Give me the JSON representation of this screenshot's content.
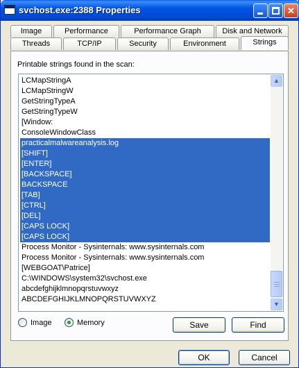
{
  "window": {
    "title": "svchost.exe:2388 Properties"
  },
  "titlebar_buttons": {
    "minimize_icon": "minimize-icon",
    "maximize_icon": "maximize-icon",
    "close_glyph": "✕"
  },
  "tabs_back_row": [
    "Image",
    "Performance",
    "Performance Graph",
    "Disk and Network"
  ],
  "tabs_front_row": [
    "Threads",
    "TCP/IP",
    "Security",
    "Environment",
    "Strings"
  ],
  "active_tab": "Strings",
  "panel": {
    "label": "Printable strings found in the scan:"
  },
  "strings_list": {
    "items": [
      {
        "text": "LCMapStringA",
        "selected": false
      },
      {
        "text": "LCMapStringW",
        "selected": false
      },
      {
        "text": "GetStringTypeA",
        "selected": false
      },
      {
        "text": "GetStringTypeW",
        "selected": false
      },
      {
        "text": "[Window:",
        "selected": false
      },
      {
        "text": "ConsoleWindowClass",
        "selected": false
      },
      {
        "text": "practicalmalwareanalysis.log",
        "selected": true
      },
      {
        "text": "[SHIFT]",
        "selected": true
      },
      {
        "text": "[ENTER]",
        "selected": true
      },
      {
        "text": "[BACKSPACE]",
        "selected": true
      },
      {
        "text": "BACKSPACE",
        "selected": true
      },
      {
        "text": "[TAB]",
        "selected": true
      },
      {
        "text": "[CTRL]",
        "selected": true
      },
      {
        "text": "[DEL]",
        "selected": true
      },
      {
        "text": "[CAPS LOCK]",
        "selected": true
      },
      {
        "text": "[CAPS LOCK]",
        "selected": true
      },
      {
        "text": "Process Monitor - Sysinternals: www.sysinternals.com",
        "selected": false
      },
      {
        "text": "Process Monitor - Sysinternals: www.sysinternals.com",
        "selected": false
      },
      {
        "text": "[WEBGOAT\\Patrice]",
        "selected": false
      },
      {
        "text": "C:\\WINDOWS\\system32\\svchost.exe",
        "selected": false
      },
      {
        "text": "abcdefghijklmnopqrstuvwxyz",
        "selected": false
      },
      {
        "text": "ABCDEFGHIJKLMNOPQRSTUVWXYZ",
        "selected": false
      }
    ],
    "scroll_up_glyph": "▲",
    "scroll_down_glyph": "▼"
  },
  "source_options": [
    {
      "label": "Image",
      "checked": false
    },
    {
      "label": "Memory",
      "checked": true
    }
  ],
  "buttons": {
    "save": "Save",
    "find": "Find",
    "ok": "OK",
    "cancel": "Cancel"
  },
  "colors": {
    "selection": "#316AC5",
    "titlebar": "#0054E3",
    "face": "#ECE9D8"
  }
}
